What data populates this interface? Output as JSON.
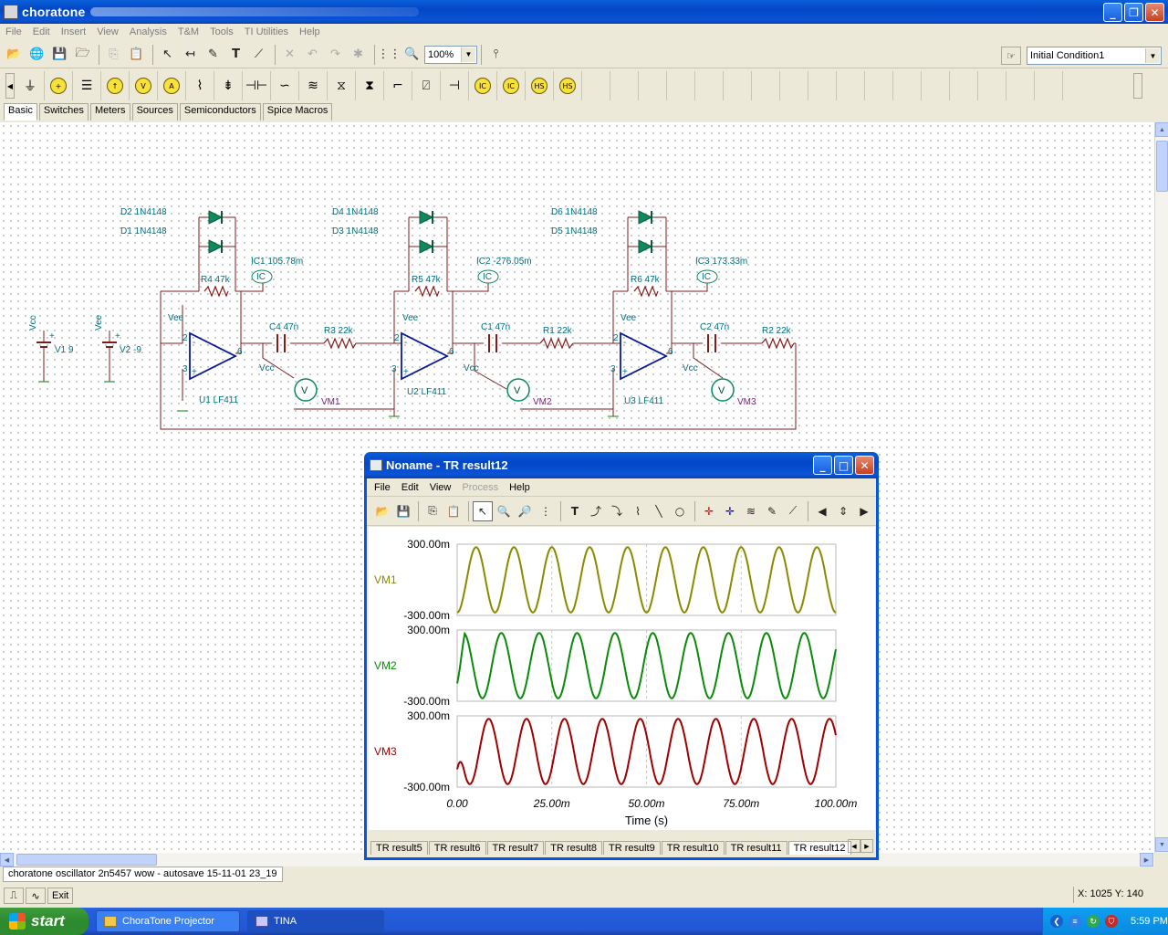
{
  "window": {
    "title": "choratone"
  },
  "menu": [
    "File",
    "Edit",
    "Insert",
    "View",
    "Analysis",
    "T&M",
    "Tools",
    "TI Utilities",
    "Help"
  ],
  "toolbar": {
    "zoom": "100%",
    "initial_condition": "Initial Condition1"
  },
  "component_tabs": [
    "Basic",
    "Switches",
    "Meters",
    "Sources",
    "Semiconductors",
    "Spice Macros"
  ],
  "circuit": {
    "labels": {
      "d2": "D2 1N4148",
      "d1": "D1 1N4148",
      "d4": "D4 1N4148",
      "d3": "D3 1N4148",
      "d6": "D6 1N4148",
      "d5": "D5 1N4148",
      "ic1": "IC1 105.78m",
      "ic2": "IC2 -276.05m",
      "ic3": "IC3 173.33m",
      "r4": "R4 47k",
      "r5": "R5 47k",
      "r6": "R6 47k",
      "c4": "C4 47n",
      "c1": "C1 47n",
      "c2": "C2 47n",
      "r3": "R3 22k",
      "r1": "R1 22k",
      "r2": "R2 22k",
      "u1": "U1 LF411",
      "u2": "U2 LF411",
      "u3": "U3 LF411",
      "vm1": "VM1",
      "vm2": "VM2",
      "vm3": "VM3",
      "v1": "V1 9",
      "v2": "V2 -9",
      "vcc": "Vcc",
      "vee": "Vee",
      "ic": "IC",
      "v": "V",
      "pin2": "2",
      "pin3": "3",
      "pin6": "6",
      "plus": "+",
      "minus": "-"
    }
  },
  "document_tab": "choratone oscillator 2n5457 wow - autosave 15-11-01 23_19",
  "bottom": {
    "exit": "Exit",
    "coords": "X: 1025  Y: 140"
  },
  "trwindow": {
    "title": "Noname - TR result12",
    "menu": [
      "File",
      "Edit",
      "View",
      "Process",
      "Help"
    ],
    "tabs": [
      "TR result5",
      "TR result6",
      "TR result7",
      "TR result8",
      "TR result9",
      "TR result10",
      "TR result11",
      "TR result12"
    ],
    "active_tab": "TR result12"
  },
  "chart_data": {
    "type": "line",
    "xlabel": "Time (s)",
    "x_ticks": [
      "0.00",
      "25.00m",
      "50.00m",
      "75.00m",
      "100.00m"
    ],
    "xlim": [
      0,
      0.1
    ],
    "grid": true,
    "series": [
      {
        "name": "VM1",
        "color": "#8a8a00",
        "ylim": [
          -0.3,
          0.3
        ],
        "y_ticks": [
          "300.00m",
          "-300.00m"
        ],
        "amplitude": 0.275,
        "period": 0.01,
        "phase_deg": 270,
        "startup": false
      },
      {
        "name": "VM2",
        "color": "#0a8a0a",
        "ylim": [
          -0.3,
          0.3
        ],
        "y_ticks": [
          "300.00m",
          "-300.00m"
        ],
        "amplitude": 0.275,
        "period": 0.01,
        "phase_deg": 30,
        "startup": true
      },
      {
        "name": "VM3",
        "color": "#a00000",
        "ylim": [
          -0.3,
          0.3
        ],
        "y_ticks": [
          "300.00m",
          "-300.00m"
        ],
        "amplitude": 0.275,
        "period": 0.01,
        "phase_deg": 150,
        "startup": true
      }
    ]
  },
  "taskbar": {
    "start": "start",
    "tasks": [
      "ChoraTone Projector",
      "TINA"
    ],
    "clock": "5:59 PM"
  }
}
